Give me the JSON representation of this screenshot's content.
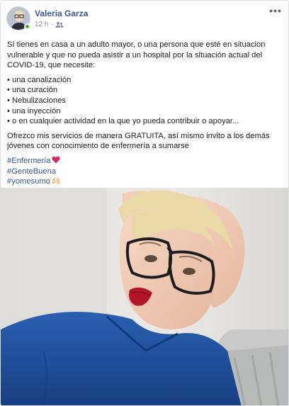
{
  "post": {
    "author": "Valeria Garza",
    "time": "12 h",
    "separator": "·",
    "audience_icon": "friends-icon",
    "more_label": "•••",
    "intro": "Sí tienes en casa a un adulto mayor, o una persona que esté en situacion vulnerable y que no pueda asistir a un hospital por la situación actual del COVID-19, que necesite:",
    "items": [
      "• una canalización",
      "• una curación",
      "• Nebulizaciones",
      "• una inyección",
      "• o en cualquier actividad en la que yo pueda contribuir o apoyar..."
    ],
    "offer": "Ofrezco mis servicios de manera GRATUITA, así mismo invito a los demás jóvenes con conocimiento de enfermería a sumarse",
    "hashtags": [
      "#Enfermería",
      "#GenteBuena",
      "#yomesumo"
    ],
    "hashtag_emojis": [
      "red-heart-icon",
      "",
      "raised-hands-icon"
    ],
    "photo_description_icon": "photo-of-nurse"
  },
  "colors": {
    "link": "#385898",
    "meta": "#90949c",
    "online": "#42b72a",
    "scrubs": "#1f4f9a",
    "heart": "#e0245e"
  }
}
